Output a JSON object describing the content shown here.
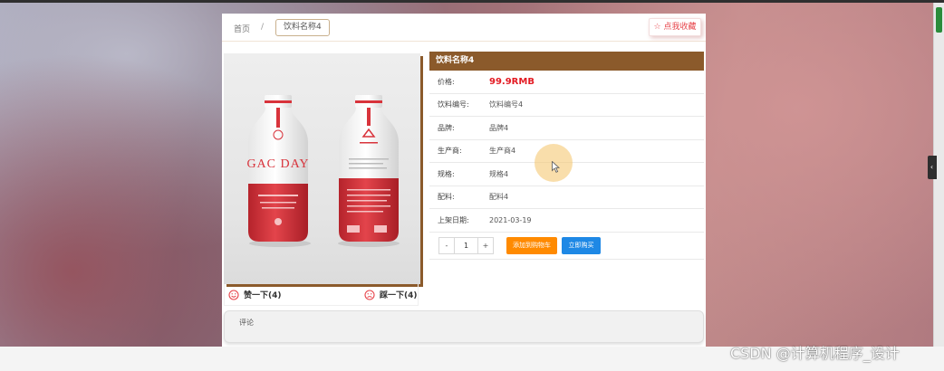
{
  "breadcrumb": {
    "home": "首页",
    "separator": "/",
    "current": "饮料名称4"
  },
  "favorite_label": "☆ 点我收藏",
  "product": {
    "title": "饮料名称4",
    "price_label": "价格:",
    "price_value": "99.9RMB",
    "fields": [
      {
        "label": "饮料编号:",
        "value": "饮料编号4"
      },
      {
        "label": "品牌:",
        "value": "品牌4"
      },
      {
        "label": "生产商:",
        "value": "生产商4"
      },
      {
        "label": "规格:",
        "value": "规格4"
      },
      {
        "label": "配料:",
        "value": "配料4"
      },
      {
        "label": "上架日期:",
        "value": "2021-03-19"
      }
    ],
    "bottle_text": "GAC DAY"
  },
  "quantity": {
    "minus": "-",
    "value": "1",
    "plus": "+"
  },
  "buttons": {
    "add_to_cart": "添加到购物车",
    "buy_now": "立即购买"
  },
  "votes": {
    "like": "赞一下(4)",
    "dislike": "踩一下(4)"
  },
  "comments_tab": "评论",
  "watermark": "CSDN @计算机程序_设计",
  "side_toggle_icon": "‹",
  "colors": {
    "accent_brown": "#8b5a2b",
    "price_red": "#e31b23",
    "cart_orange": "#ff8a00",
    "buy_blue": "#1e88e5",
    "favorite_red": "#e7444a"
  },
  "icons": {
    "like": "smile-icon",
    "dislike": "frown-icon",
    "favorite": "star-icon",
    "cursor": "mouse-pointer-icon"
  }
}
